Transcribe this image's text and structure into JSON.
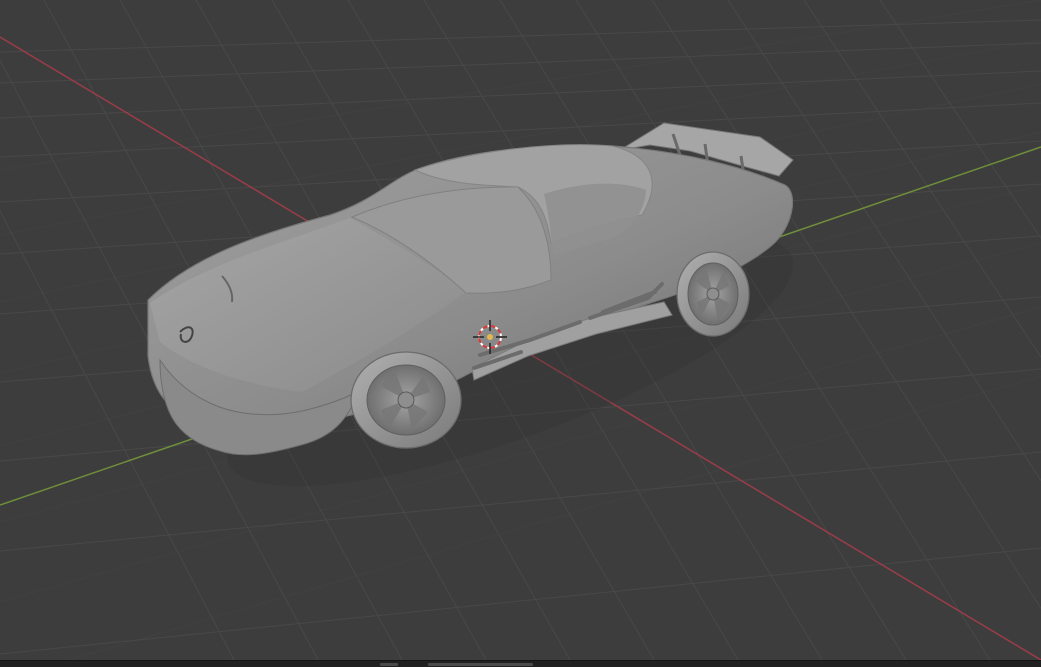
{
  "app": {
    "name": "",
    "mode": "3D viewport",
    "shading": "solid"
  },
  "viewport": {
    "background_color": "#3d3d3d",
    "grid_color": "#4b4b4b",
    "x_axis_color": "#9b3d48",
    "y_axis_color": "#6f8f3a",
    "model_color": "#8d8d8d",
    "model_shadow_color": "#6f6f6f",
    "cursor_icon": "3d-cursor-icon"
  },
  "statusbar": {
    "segments": [
      "",
      ""
    ]
  }
}
